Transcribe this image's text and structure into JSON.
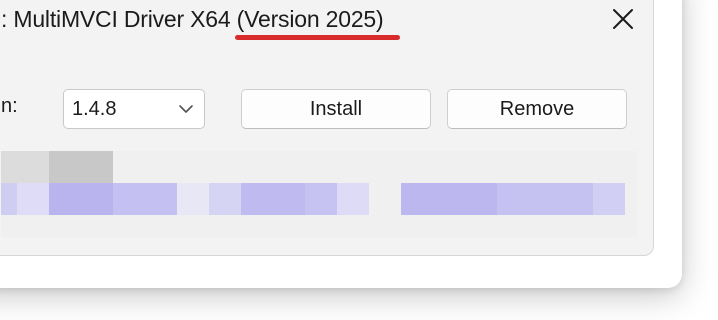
{
  "window": {
    "title_prefix": ": MultiMVCI Driver X64 ",
    "title_marked": "(Version 2025)",
    "close_symbol": "✕"
  },
  "form": {
    "version_label": "n:",
    "version_select_value": "1.4.8",
    "install_label": "Install",
    "remove_label": "Remove"
  },
  "colors": {
    "annotation_underline": "#d92b2b",
    "redacted_gray": "#c8c8c8",
    "redacted_purple": "#b9b4ee"
  }
}
